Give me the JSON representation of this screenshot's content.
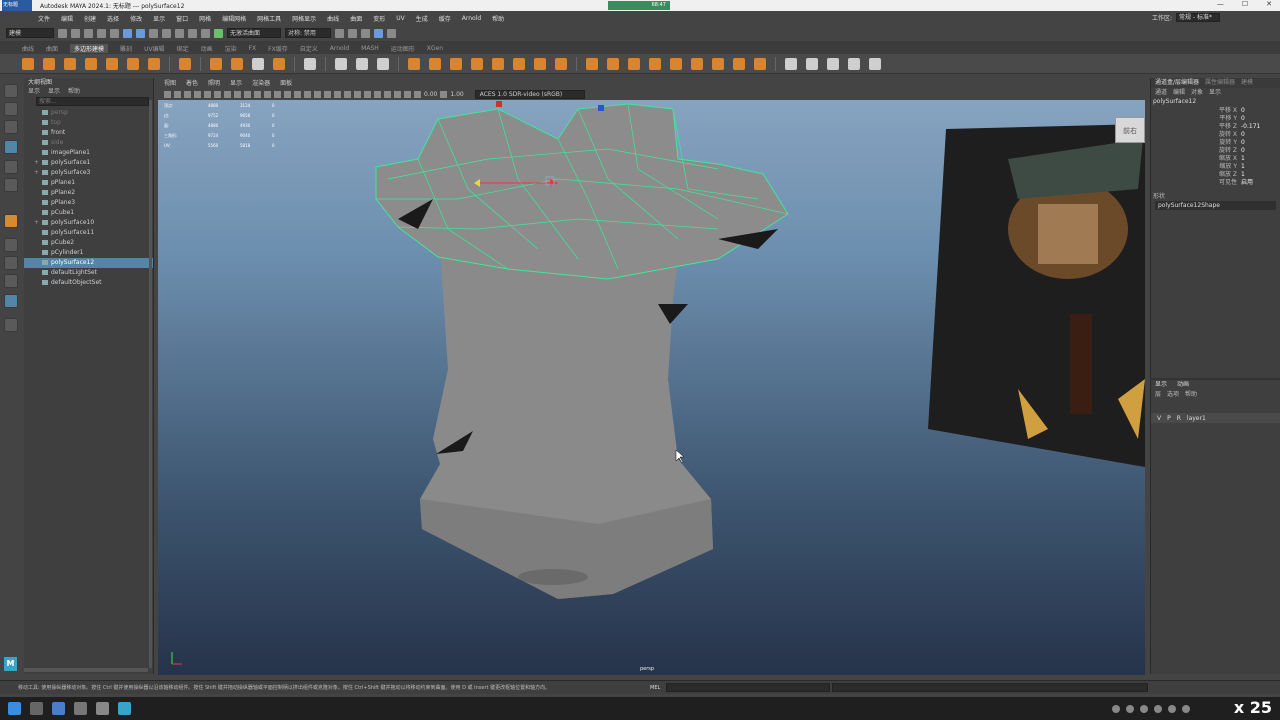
{
  "window": {
    "title": "Autodesk MAYA 2024.1: 无标题  ---  polySurface12",
    "logo_text": "无标题",
    "clock": "68:47",
    "min": "—",
    "max": "☐",
    "close": "✕"
  },
  "menus": [
    "文件",
    "编辑",
    "创建",
    "选择",
    "修改",
    "显示",
    "窗口",
    "网格",
    "编辑网格",
    "网格工具",
    "网格显示",
    "曲线",
    "曲面",
    "变形",
    "UV",
    "生成",
    "缓存",
    "Arnold",
    "帮助"
  ],
  "workspace": {
    "label": "工作区:",
    "value": "常规 - 标准*"
  },
  "status": {
    "mode": "建模",
    "symmetry": "无激活曲面",
    "sym_label": "对称: 禁用"
  },
  "shelf_tabs": [
    "曲线",
    "曲面",
    "多边形建模",
    "雕刻",
    "UV编辑",
    "绑定",
    "动画",
    "渲染",
    "FX",
    "FX缓存",
    "自定义",
    "Arnold",
    "MASH",
    "运动图形",
    "XGen"
  ],
  "shelf_active": "多边形建模",
  "outliner": {
    "title": "大纲视图",
    "menu": [
      "显示",
      "显示",
      "帮助"
    ],
    "search_placeholder": "搜索...",
    "items": [
      {
        "label": "persp",
        "dim": true,
        "plus": false
      },
      {
        "label": "top",
        "dim": true,
        "plus": false
      },
      {
        "label": "front",
        "dim": false,
        "plus": false
      },
      {
        "label": "side",
        "dim": true,
        "plus": false
      },
      {
        "label": "imagePlane1",
        "dim": false,
        "plus": false
      },
      {
        "label": "polySurface1",
        "dim": false,
        "plus": true
      },
      {
        "label": "polySurface3",
        "dim": false,
        "plus": true
      },
      {
        "label": "pPlane1",
        "dim": false,
        "plus": false
      },
      {
        "label": "pPlane2",
        "dim": false,
        "plus": false
      },
      {
        "label": "pPlane3",
        "dim": false,
        "plus": false
      },
      {
        "label": "pCube1",
        "dim": false,
        "plus": false
      },
      {
        "label": "polySurface10",
        "dim": false,
        "plus": true
      },
      {
        "label": "polySurface11",
        "dim": false,
        "plus": false
      },
      {
        "label": "pCube2",
        "dim": false,
        "plus": false
      },
      {
        "label": "pCylinder1",
        "dim": false,
        "plus": false
      },
      {
        "label": "polySurface12",
        "dim": false,
        "plus": false,
        "selected": true
      },
      {
        "label": "defaultLightSet",
        "dim": false,
        "plus": false
      },
      {
        "label": "defaultObjectSet",
        "dim": false,
        "plus": false
      }
    ]
  },
  "viewport": {
    "menu": [
      "视图",
      "着色",
      "照明",
      "显示",
      "渲染器",
      "面板"
    ],
    "gamma": "0.00",
    "exposure": "1.00",
    "colorspace": "ACES 1.0 SDR-video (sRGB)",
    "hud": [
      {
        "k": "顶点:",
        "a": "4880",
        "b": "3124",
        "c": "0"
      },
      {
        "k": "边:",
        "a": "9752",
        "b": "9658",
        "c": "0"
      },
      {
        "k": "面:",
        "a": "4880",
        "b": "4930",
        "c": "0"
      },
      {
        "k": "三角形:",
        "a": "9724",
        "b": "9040",
        "c": "0"
      },
      {
        "k": "UV:",
        "a": "5560",
        "b": "5818",
        "c": "0"
      }
    ],
    "viewcube": "前右",
    "camera": "persp"
  },
  "attr": {
    "tabs": [
      "通道盒/层编辑器",
      "属性编辑器",
      "建模"
    ],
    "menu": [
      "通道",
      "编辑",
      "对象",
      "显示"
    ],
    "object": "polySurface12",
    "rows": [
      {
        "k": "平移 X",
        "v": "0"
      },
      {
        "k": "平移 Y",
        "v": "0"
      },
      {
        "k": "平移 Z",
        "v": "-0.171"
      },
      {
        "k": "旋转 X",
        "v": "0"
      },
      {
        "k": "旋转 Y",
        "v": "0"
      },
      {
        "k": "旋转 Z",
        "v": "0"
      },
      {
        "k": "缩放 X",
        "v": "1"
      },
      {
        "k": "缩放 Y",
        "v": "1"
      },
      {
        "k": "缩放 Z",
        "v": "1"
      },
      {
        "k": "可见性",
        "v": "启用"
      }
    ],
    "shapes_label": "形状",
    "shape_name": "polySurface12Shape"
  },
  "layers": {
    "tabs": [
      "显示",
      "动画"
    ],
    "menu": [
      "层",
      "选项",
      "帮助"
    ],
    "row": {
      "v": "V",
      "p": "P",
      "r": "R",
      "name": "layer1"
    }
  },
  "helpline": {
    "text": "移动工具: 使用操纵器移动对象。按住 Ctrl 键并使用操纵器以沿该轴移动组件。按住 Shift 键并拖动操纵器轴或平面控制柄以挤出组件或克隆对象。按住 Ctrl+Shift 键并拖动以将移动约束到曲面。使用 D 或 Insert 键更改枢轴位置和轴方向。",
    "mel": "MEL"
  },
  "taskbar": {
    "speed": "x 25"
  },
  "colors": {
    "accent": "#5285a6",
    "wire": "#3ee89a",
    "shelf_icon": "#d9842f"
  }
}
